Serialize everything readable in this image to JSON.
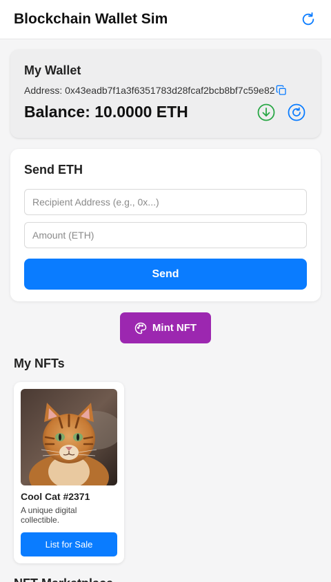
{
  "header": {
    "title": "Blockchain Wallet Sim",
    "refresh_icon": "refresh-icon"
  },
  "wallet": {
    "title": "My Wallet",
    "address_label": "Address: 0x43eadb7f1a3f6351783d28fcaf2bcb8bf7c59e82",
    "balance_label": "Balance: 10.0000 ETH",
    "icons": [
      "copy-icon",
      "receive-icon",
      "refresh-balance-icon"
    ],
    "colors": {
      "receive": "#28a745",
      "refresh": "#0a7cff"
    }
  },
  "send": {
    "title": "Send ETH",
    "recipient_placeholder": "Recipient Address (e.g., 0x...)",
    "amount_placeholder": "Amount (ETH)",
    "recipient_value": "",
    "amount_value": "",
    "button_label": "Send"
  },
  "mint": {
    "button_label": "Mint NFT",
    "icon": "palette-icon",
    "color": "#9c27b0"
  },
  "nfts": {
    "title": "My NFTs",
    "items": [
      {
        "name": "Cool Cat #2371",
        "description": "A unique digital collectible.",
        "button_label": "List for Sale"
      }
    ]
  },
  "marketplace": {
    "title": "NFT Marketplace"
  },
  "colors": {
    "accent": "#0a7cff",
    "background": "#f5f5f6"
  }
}
